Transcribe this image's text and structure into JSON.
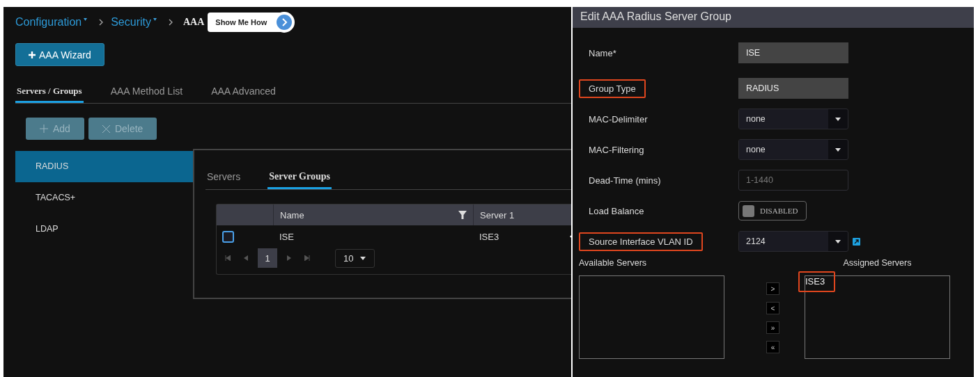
{
  "breadcrumb": [
    {
      "label": "Configuration",
      "dropdown": true
    },
    {
      "label": "Security",
      "dropdown": true
    },
    {
      "label": "AAA",
      "dropdown": false
    }
  ],
  "show_me_how": {
    "label": "Show Me How"
  },
  "wizard_button": {
    "label": "AAA Wizard"
  },
  "tabs": [
    {
      "label": "Servers / Groups",
      "selected": true
    },
    {
      "label": "AAA Method List",
      "selected": false
    },
    {
      "label": "AAA Advanced",
      "selected": false
    }
  ],
  "actions": [
    {
      "label": "Add",
      "kind": "add",
      "disabled": true
    },
    {
      "label": "Delete",
      "kind": "delete",
      "disabled": true
    }
  ],
  "sidebar": {
    "items": [
      {
        "label": "RADIUS",
        "selected": true
      },
      {
        "label": "TACACS+",
        "selected": false
      },
      {
        "label": "LDAP",
        "selected": false
      }
    ]
  },
  "panel": {
    "tabs": [
      {
        "label": "Servers",
        "selected": false
      },
      {
        "label": "Server Groups",
        "selected": true
      }
    ],
    "table": {
      "columns": [
        "Name",
        "Server 1"
      ],
      "rows": [
        {
          "checked": false,
          "cells": [
            "ISE",
            "ISE3"
          ]
        }
      ],
      "pager": {
        "current": "1",
        "page_size": "10"
      }
    }
  },
  "dialog": {
    "title": "Edit AAA Radius Server Group",
    "fields": [
      {
        "label": "Name*",
        "kind": "text",
        "value": "ISE",
        "highlighted": false
      },
      {
        "label": "Group Type",
        "kind": "text",
        "value": "RADIUS",
        "highlighted": true
      },
      {
        "label": "MAC-Delimiter",
        "kind": "select",
        "value": "none",
        "highlighted": false
      },
      {
        "label": "MAC-Filtering",
        "kind": "select",
        "value": "none",
        "highlighted": false
      },
      {
        "label": "Dead-Time (mins)",
        "kind": "input",
        "placeholder": "1-1440",
        "highlighted": false
      },
      {
        "label": "Load Balance",
        "kind": "toggle",
        "on": false,
        "value": "DISABLED",
        "highlighted": false
      },
      {
        "label": "Source Interface VLAN ID",
        "kind": "select",
        "value": "2124",
        "highlighted": true,
        "link": true
      }
    ],
    "available": {
      "label": "Available Servers"
    },
    "assigned": {
      "label": "Assigned Servers",
      "items": [
        {
          "label": "ISE3",
          "highlighted": true
        }
      ]
    },
    "move_buttons": [
      ">",
      "<",
      "»",
      "«"
    ]
  }
}
